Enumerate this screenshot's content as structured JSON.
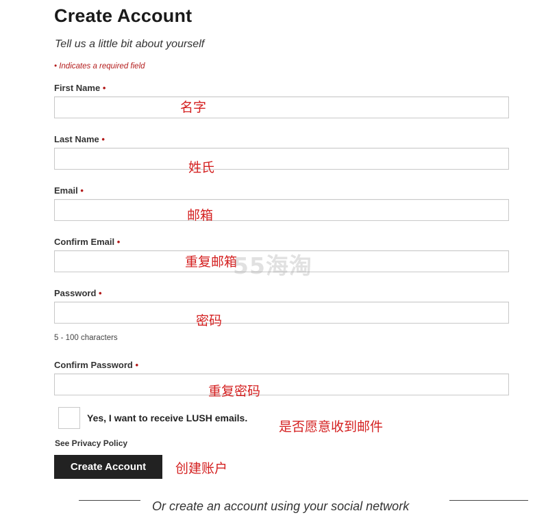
{
  "form": {
    "title": "Create Account",
    "subtitle": "Tell us a little bit about yourself",
    "required_note": "• Indicates a required field",
    "required_marker": "•",
    "fields": [
      {
        "label": "First Name",
        "value": "",
        "annotation": "名字"
      },
      {
        "label": "Last Name",
        "value": "",
        "annotation": "姓氏"
      },
      {
        "label": "Email",
        "value": "",
        "annotation": "邮箱"
      },
      {
        "label": "Confirm Email",
        "value": "",
        "annotation": "重复邮箱"
      },
      {
        "label": "Password",
        "value": "",
        "annotation": "密码"
      },
      {
        "label": "Confirm Password",
        "value": "",
        "annotation": "重复密码"
      }
    ],
    "password_hint": "5 - 100 characters",
    "newsletter_label": "Yes, I want to receive LUSH emails.",
    "newsletter_checked": false,
    "newsletter_annotation": "是否愿意收到邮件",
    "privacy_link": "See Privacy Policy",
    "submit_label": "Create Account",
    "submit_annotation": "创建账户",
    "social_text": "Or create an account using your social network"
  },
  "watermark": "55海淘",
  "colors": {
    "required": "#b31b1b",
    "annotation": "#d42020",
    "button_bg": "#222222",
    "button_text": "#ffffff"
  }
}
